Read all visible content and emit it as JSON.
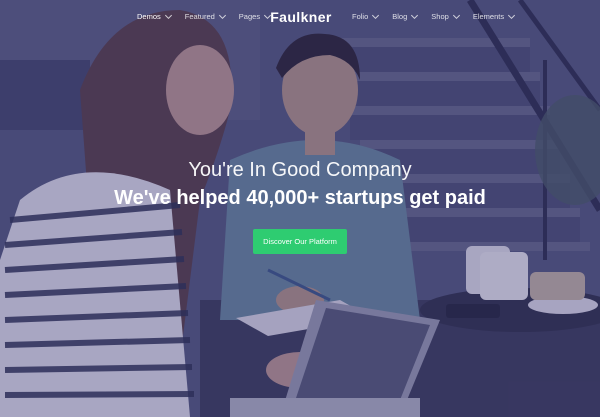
{
  "brand": {
    "logo_text": "Faulkner"
  },
  "nav": {
    "left_items": [
      {
        "label": "Demos",
        "active": true
      },
      {
        "label": "Featured",
        "active": false
      },
      {
        "label": "Pages",
        "active": false
      }
    ],
    "right_items": [
      {
        "label": "Folio",
        "active": false
      },
      {
        "label": "Blog",
        "active": false
      },
      {
        "label": "Shop",
        "active": false
      },
      {
        "label": "Elements",
        "active": false
      }
    ]
  },
  "hero": {
    "tagline": "You're In Good Company",
    "headline": "We've helped 40,000+ startups get paid",
    "cta_label": "Discover Our Platform"
  },
  "colors": {
    "overlay": "#322e6e",
    "cta": "#2ecc71",
    "text": "#ffffff"
  }
}
